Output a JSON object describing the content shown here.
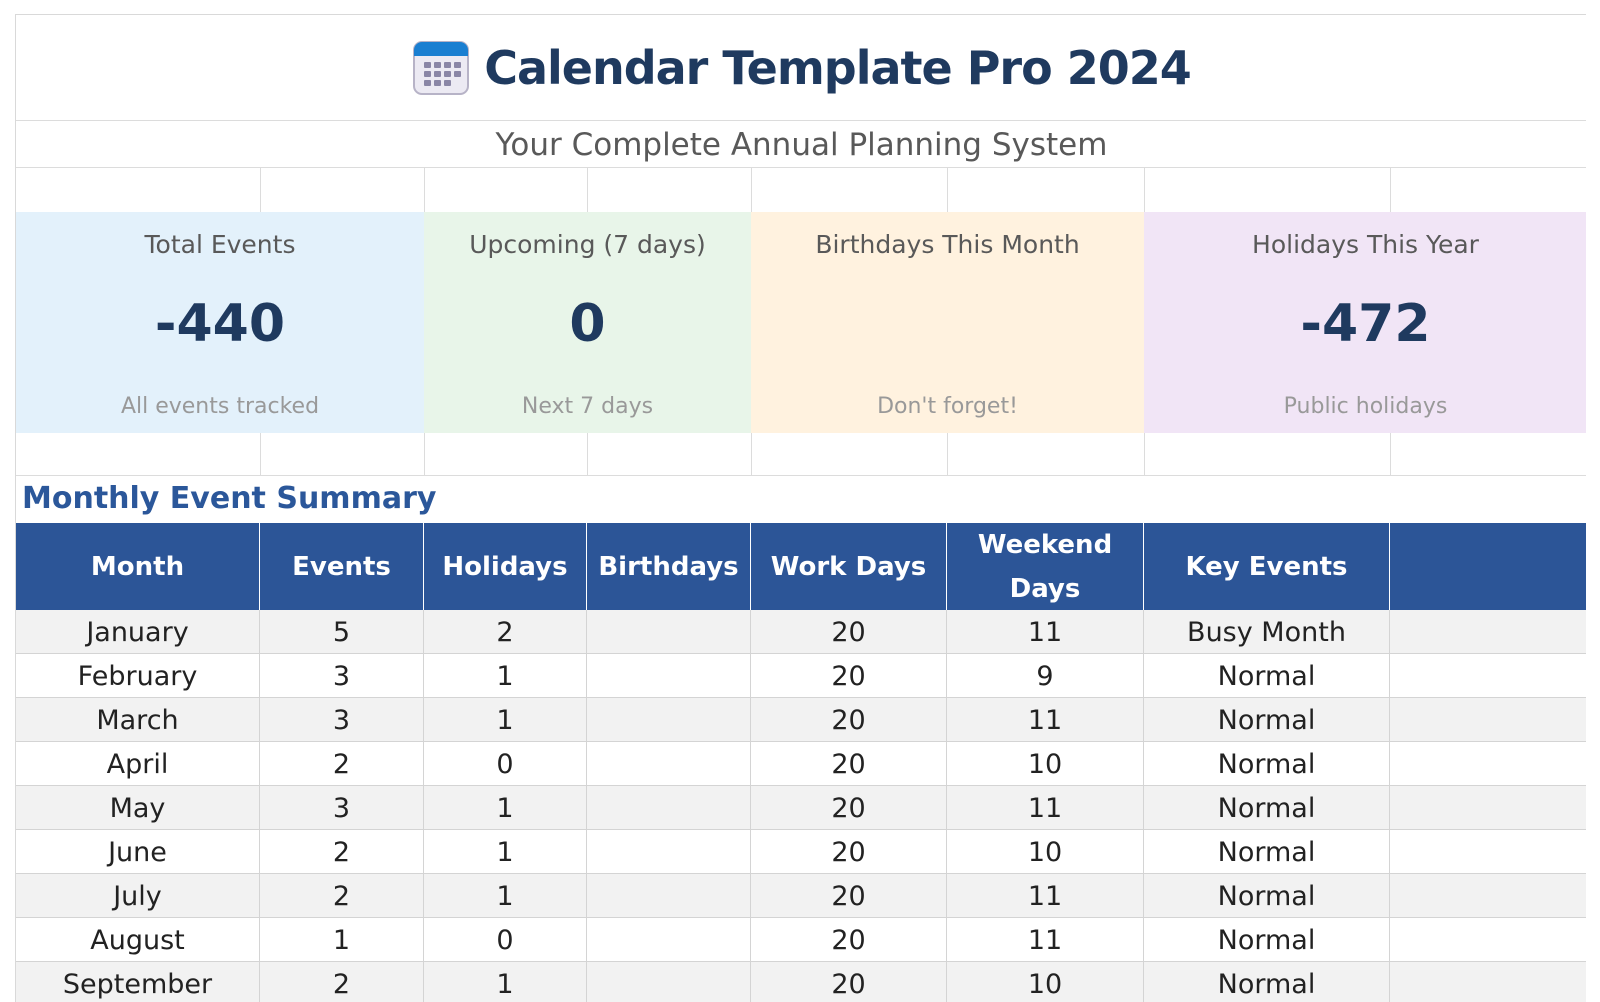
{
  "header": {
    "title": "Calendar Template Pro 2024",
    "subtitle": "Your Complete Annual Planning System",
    "icon": "calendar-icon"
  },
  "cards": [
    {
      "label": "Total Events",
      "value": "-440",
      "sub": "All events tracked",
      "bg": "#e3f1fb"
    },
    {
      "label": "Upcoming (7 days)",
      "value": "0",
      "sub": "Next 7 days",
      "bg": "#e8f5e9"
    },
    {
      "label": "Birthdays This Month",
      "value": "",
      "sub": "Don't forget!",
      "bg": "#fff2df"
    },
    {
      "label": "Holidays This Year",
      "value": "-472",
      "sub": "Public holidays",
      "bg": "#f1e5f6"
    }
  ],
  "summary": {
    "title": "Monthly Event Summary",
    "columns": [
      "Month",
      "Events",
      "Holidays",
      "Birthdays",
      "Work Days",
      "Weekend Days",
      "Key Events",
      ""
    ],
    "rows": [
      [
        "January",
        "5",
        "2",
        "",
        "20",
        "11",
        "Busy Month",
        ""
      ],
      [
        "February",
        "3",
        "1",
        "",
        "20",
        "9",
        "Normal",
        ""
      ],
      [
        "March",
        "3",
        "1",
        "",
        "20",
        "11",
        "Normal",
        ""
      ],
      [
        "April",
        "2",
        "0",
        "",
        "20",
        "10",
        "Normal",
        ""
      ],
      [
        "May",
        "3",
        "1",
        "",
        "20",
        "11",
        "Normal",
        ""
      ],
      [
        "June",
        "2",
        "1",
        "",
        "20",
        "10",
        "Normal",
        ""
      ],
      [
        "July",
        "2",
        "1",
        "",
        "20",
        "11",
        "Normal",
        ""
      ],
      [
        "August",
        "1",
        "0",
        "",
        "20",
        "11",
        "Normal",
        ""
      ],
      [
        "September",
        "2",
        "1",
        "",
        "20",
        "10",
        "Normal",
        ""
      ]
    ]
  },
  "colors": {
    "header_bg": "#2c5597",
    "title": "#1f3a5f",
    "section_title": "#2b579a"
  }
}
